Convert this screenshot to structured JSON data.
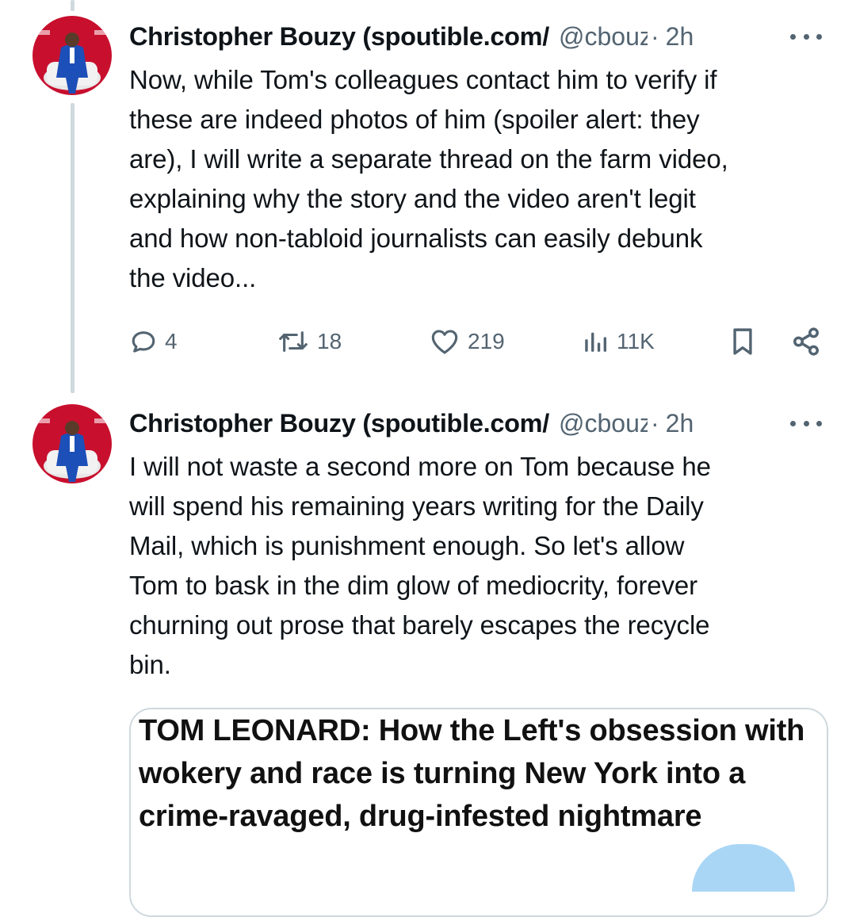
{
  "tweets": [
    {
      "author_name": "Christopher Bouzy (spoutible.com/",
      "handle": "@cbouzy",
      "separator": "·",
      "time": "2h",
      "text": "Now, while Tom's colleagues contact him to verify if\nthese are indeed photos of him (spoiler alert: they\nare), I will write a separate thread on the farm video,\nexplaining why the story and the video aren't legit\nand how non-tabloid journalists can easily debunk\nthe video...",
      "replies": "4",
      "reposts": "18",
      "likes": "219",
      "views": "11K"
    },
    {
      "author_name": "Christopher Bouzy (spoutible.com/",
      "handle": "@cbouzy",
      "separator": "·",
      "time": "2h",
      "text": "I will not waste a second more on Tom because he\nwill spend his remaining years writing for the Daily\nMail, which is punishment enough. So let's allow\nTom to bask in the dim glow of mediocrity, forever\nchurning out prose that barely escapes the recycle\nbin.",
      "card": {
        "headline": "TOM LEONARD: How the Left's obsession with wokery and race is turning New York into a crime-ravaged, drug-infested nightmare"
      }
    }
  ],
  "icons": {
    "reply": "reply-icon",
    "repost": "repost-icon",
    "like": "heart-icon",
    "views": "views-icon",
    "bookmark": "bookmark-icon",
    "share": "share-icon",
    "more": "more-icon"
  },
  "colors": {
    "text": "#0f1419",
    "secondary": "#536471",
    "thread_line": "#cfd9de",
    "avatar_bg": "#c8102e",
    "suit": "#1d4fb8"
  }
}
